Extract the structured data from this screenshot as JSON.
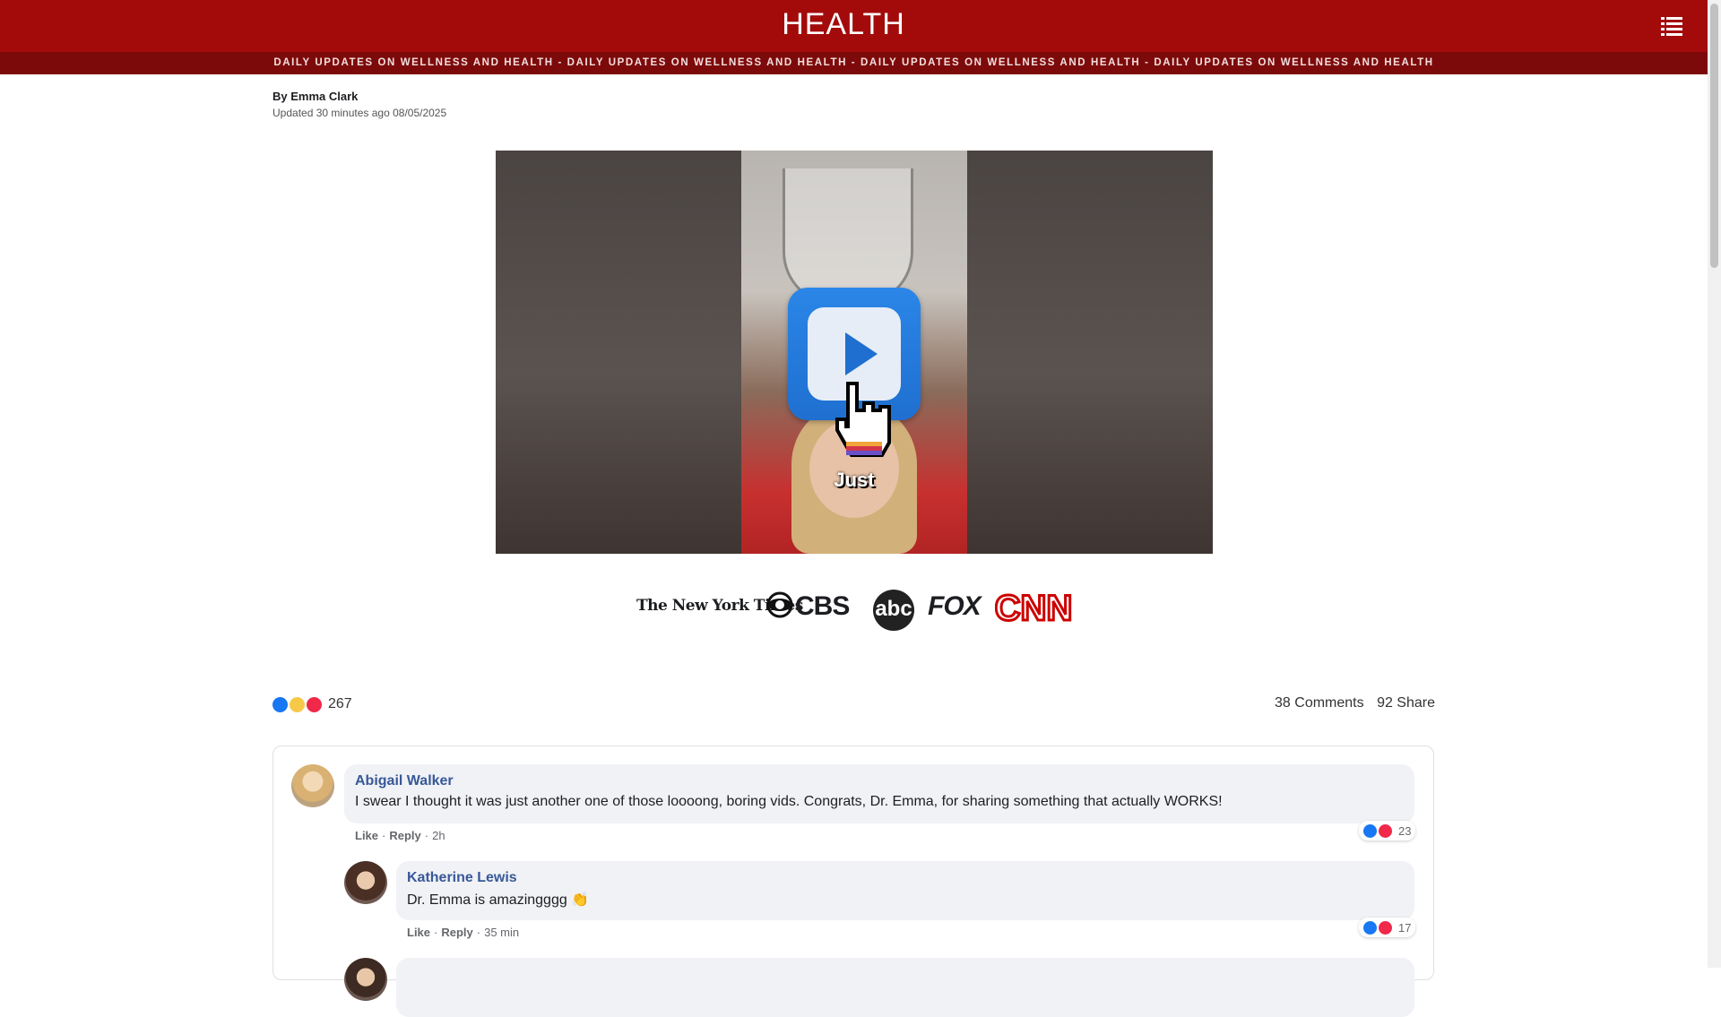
{
  "header": {
    "title": "HEALTH",
    "menu_icon": "list-menu-icon"
  },
  "ticker": {
    "text": "DAILY UPDATES ON WELLNESS AND HEALTH - DAILY UPDATES ON WELLNESS AND HEALTH - DAILY UPDATES ON WELLNESS AND HEALTH - DAILY UPDATES ON WELLNESS AND HEALTH"
  },
  "byline": {
    "author": "By Emma Clark",
    "updated": "Updated 30 minutes ago 08/05/2025"
  },
  "video": {
    "caption": "Just"
  },
  "logos": {
    "nyt": "The New York Times",
    "cbs": "CBS",
    "abc": "abc",
    "fox": "FOX",
    "cnn": "CNN"
  },
  "post_reactions": {
    "count": "267",
    "icons": [
      "like-icon",
      "wow-icon",
      "love-icon"
    ]
  },
  "post_stats": {
    "comments": "38 Comments",
    "shares": "92 Share"
  },
  "comments": [
    {
      "name": "Abigail Walker",
      "text": "I swear I thought it was just another one of those loooong, boring vids. Congrats, Dr. Emma, for sharing something that actually WORKS!",
      "like_label": "Like",
      "reply_label": "Reply",
      "time": "2h",
      "reaction_count": "23"
    },
    {
      "name": "Katherine Lewis",
      "text": "Dr. Emma is amazingggg 👏",
      "like_label": "Like",
      "reply_label": "Reply",
      "time": "35 min",
      "reaction_count": "17"
    }
  ],
  "colors": {
    "header_bg": "#a30b0b",
    "ticker_bg": "#7d0a0a",
    "name_link": "#385898",
    "like": "#1877f2",
    "love": "#f0284a"
  }
}
